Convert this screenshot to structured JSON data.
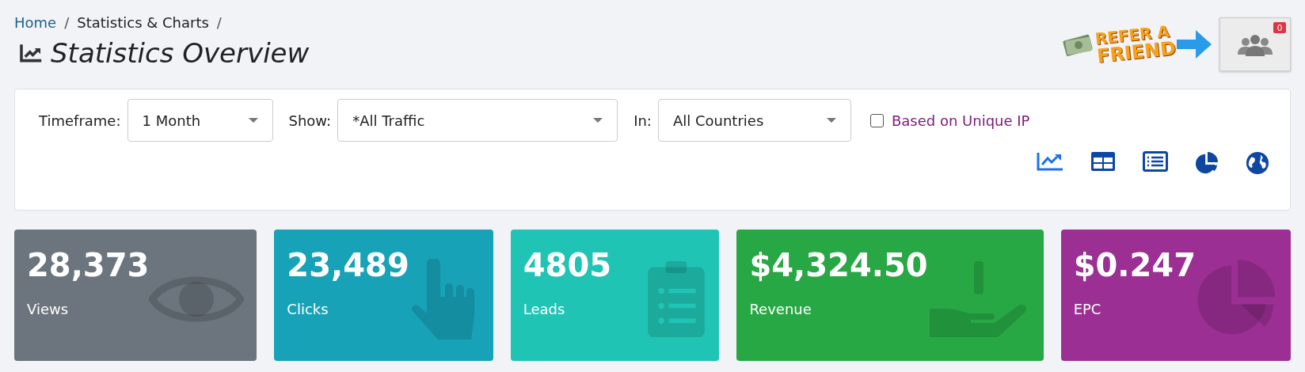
{
  "breadcrumb": [
    {
      "label": "Home",
      "kind": "link",
      "separator": "/"
    },
    {
      "label": "Statistics & Charts",
      "kind": "text",
      "separator": "/"
    }
  ],
  "page_title": "Statistics Overview",
  "promo": {
    "line_1": "REFER A",
    "line_2": "FRIEND"
  },
  "friends_button": {
    "badge": "0"
  },
  "filters": [
    {
      "label": "Timeframe:",
      "value": "1 Month"
    },
    {
      "label": "Show:",
      "value": "*All Traffic"
    },
    {
      "label": "In:",
      "value": "All Countries"
    }
  ],
  "unique_ip": {
    "label": "Based on Unique IP",
    "checked": false
  },
  "view_buttons": [
    {
      "kind": "line"
    },
    {
      "kind": "grid"
    },
    {
      "kind": "list"
    },
    {
      "kind": "pie"
    },
    {
      "kind": "globe"
    }
  ],
  "stats": [
    {
      "value": "28,373",
      "label": "Views",
      "kind": "eye",
      "color": "#6c757d"
    },
    {
      "value": "23,489",
      "label": "Clicks",
      "kind": "hand",
      "color": "#17a2b8"
    },
    {
      "value": "4805",
      "label": "Leads",
      "kind": "clipboard",
      "color": "#20c4b4"
    },
    {
      "value": "$4,324.50",
      "label": "Revenue",
      "kind": "money",
      "color": "#28a745"
    },
    {
      "value": "$0.247",
      "label": "EPC",
      "kind": "pie",
      "color": "#9b2f94"
    }
  ]
}
